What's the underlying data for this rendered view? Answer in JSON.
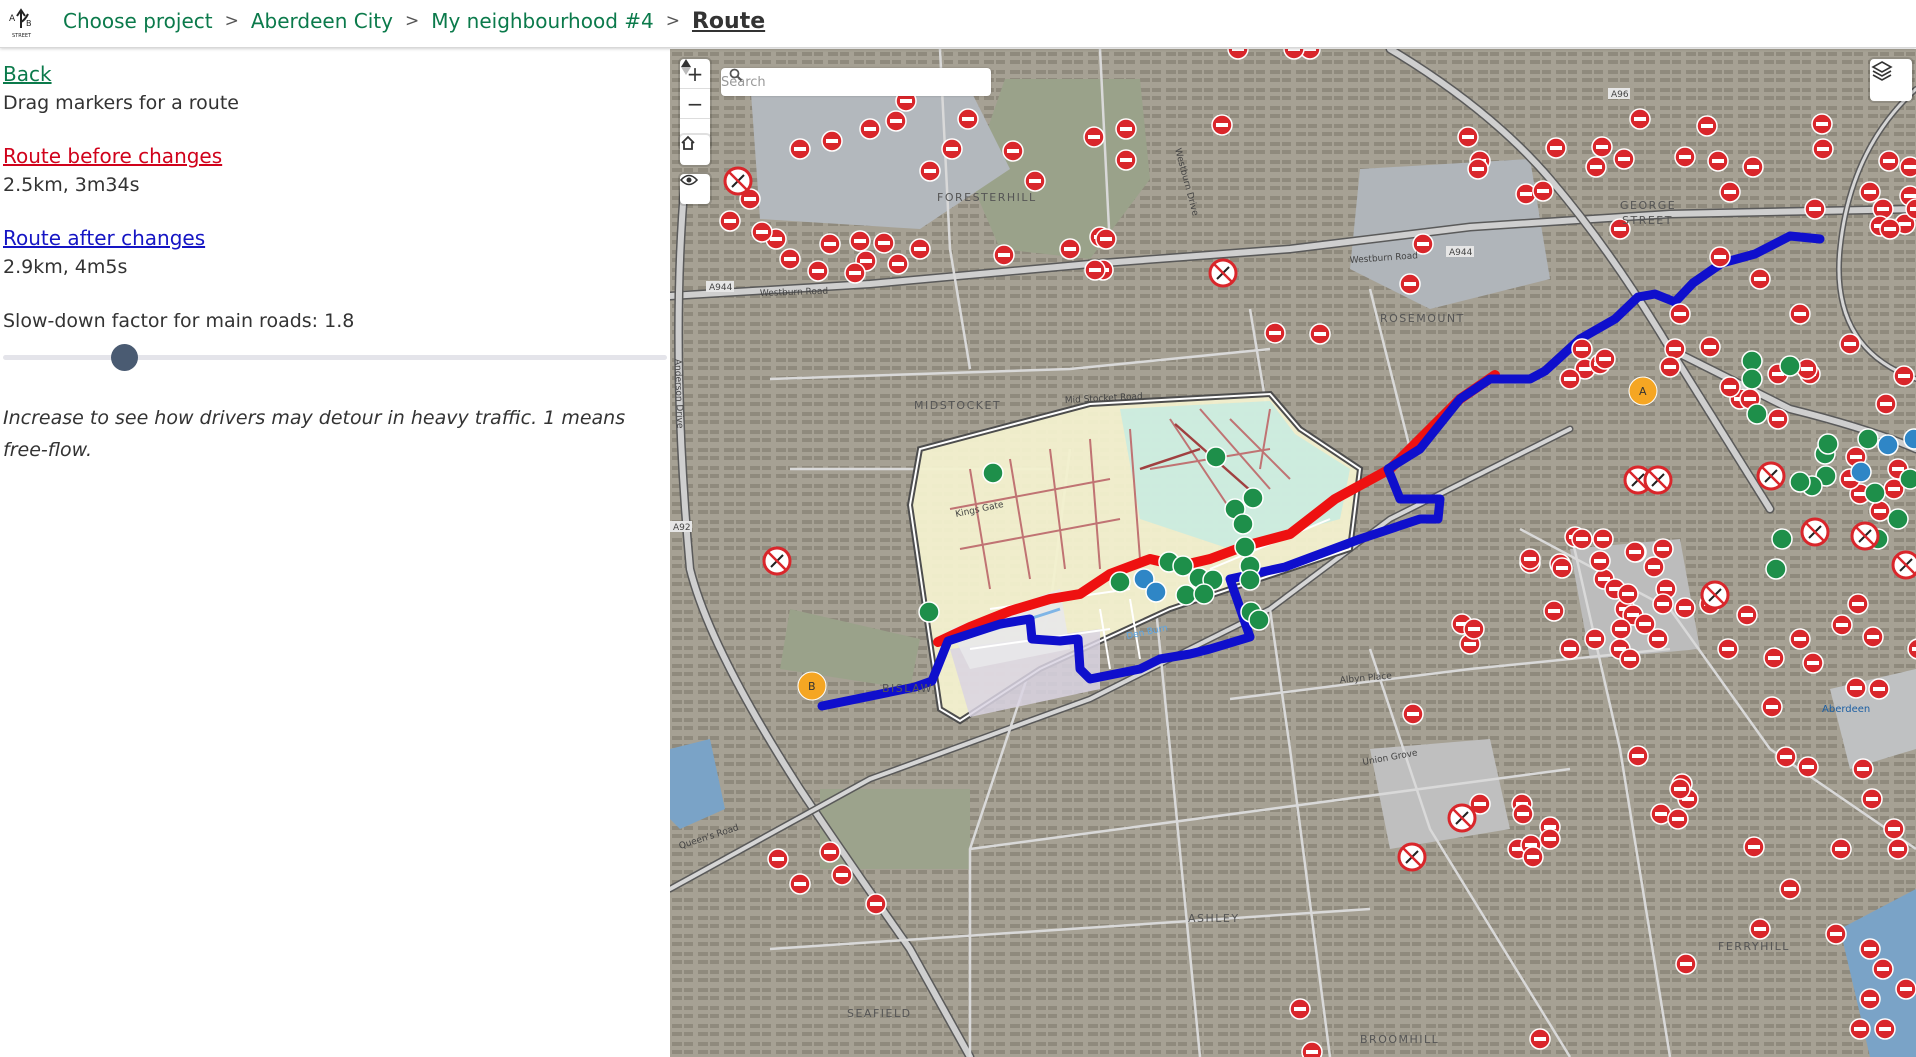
{
  "breadcrumb": {
    "items": [
      "Choose project",
      "Aberdeen City",
      "My neighbourhood #4"
    ],
    "separator": ">",
    "current": "Route"
  },
  "logo_text": "STREET",
  "panel": {
    "back": "Back",
    "instruction": "Drag markers for a route",
    "route_before": {
      "label": "Route before changes",
      "stats": "2.5km, 3m34s",
      "color": "#d0021b"
    },
    "route_after": {
      "label": "Route after changes",
      "stats": "2.9km, 4m5s",
      "color": "#1515c4"
    },
    "slowdown_label": "Slow-down factor for main roads: 1.8",
    "slowdown_value": 1.8,
    "slowdown_fraction": 0.17,
    "hint": "Increase to see how drivers may detour in heavy traffic. 1 means free-flow."
  },
  "map": {
    "search_placeholder": "Search",
    "controls": {
      "zoom_in": "+",
      "zoom_out": "−",
      "compass": "compass-icon",
      "home": "home-icon",
      "eye": "eye-icon",
      "layers": "layers-icon"
    },
    "place_labels": [
      "FORESTERHILL",
      "GEORGE",
      "STREET",
      "ROSEMOUNT",
      "MIDSTOCKET",
      "BISLAW",
      "ASHLEY",
      "FERRYHILL",
      "SEAFIELD",
      "BROOMHILL",
      "Aberdeen"
    ],
    "road_labels": [
      "A96",
      "A944",
      "A944",
      "A92",
      "Westburn Road",
      "Westburn Road",
      "Westburn Drive",
      "Mid Stocket Road",
      "Kings Gate",
      "Albyn Place",
      "Union Grove",
      "Queen's Road",
      "Den Burn",
      "Anderson Drive"
    ],
    "markers": {
      "start": "A",
      "end": "B"
    },
    "colors": {
      "route_before": "#ee1111",
      "route_after": "#0f0fcc",
      "neighbourhood_fill": "#f4f3d2",
      "marker": "#f5a623"
    }
  }
}
